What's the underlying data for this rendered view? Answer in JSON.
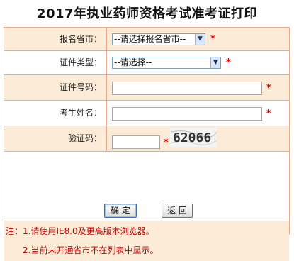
{
  "title": "2017年执业药师资格考试准考证打印",
  "form": {
    "province": {
      "label": "报名省市：",
      "selected": "--请选择报名省市--",
      "required": "*"
    },
    "id_type": {
      "label": "证件类型：",
      "selected": "--请选择--",
      "required": "*"
    },
    "id_number": {
      "label": "证件号码：",
      "value": "",
      "required": "*"
    },
    "name": {
      "label": "考生姓名：",
      "value": "",
      "required": "*"
    },
    "captcha": {
      "label": "验证码：",
      "value": "",
      "required": "*",
      "image_text": "62066"
    }
  },
  "buttons": {
    "confirm": "确 定",
    "back": "返 回"
  },
  "notes": {
    "line1": "注：1.请使用IE8.0及更高版本浏览器。",
    "line2": "2.当前未开通省市不在列表中显示。"
  },
  "colors": {
    "border": "#e9a98a",
    "row_bg": "#fcebd7",
    "required": "#e00000",
    "note": "#c00000"
  },
  "icons": [
    "dropdown-arrow-icon"
  ]
}
